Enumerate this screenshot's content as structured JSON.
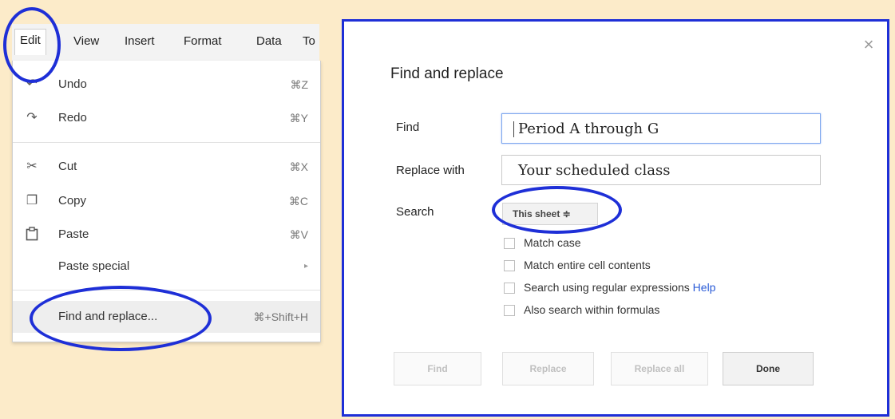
{
  "menubar": {
    "items": [
      "Edit",
      "View",
      "Insert",
      "Format",
      "Data",
      "To"
    ]
  },
  "dropdown": {
    "items": [
      {
        "icon": "undo-icon",
        "glyph": "↶",
        "label": "Undo",
        "shortcut": "⌘Z"
      },
      {
        "icon": "redo-icon",
        "glyph": "↷",
        "label": "Redo",
        "shortcut": "⌘Y"
      },
      {
        "icon": "scissors-icon",
        "glyph": "✂",
        "label": "Cut",
        "shortcut": "⌘X"
      },
      {
        "icon": "copy-icon",
        "glyph": "❐",
        "label": "Copy",
        "shortcut": "⌘C"
      },
      {
        "icon": "paste-icon",
        "glyph": "📋",
        "label": "Paste",
        "shortcut": "⌘V"
      },
      {
        "icon": "",
        "glyph": "",
        "label": "Paste special",
        "shortcut": "▸"
      },
      {
        "icon": "",
        "glyph": "",
        "label": "Find and replace...",
        "shortcut": "⌘+Shift+H"
      }
    ]
  },
  "dialog": {
    "title": "Find and replace",
    "close_glyph": "×",
    "find_label": "Find",
    "find_value": "Period A through G",
    "replace_label": "Replace with",
    "replace_value": "Your scheduled class",
    "search_label": "Search",
    "search_value": "This sheet ≑",
    "options": [
      {
        "label": "Match case"
      },
      {
        "label": "Match entire cell contents"
      },
      {
        "label": "Search using regular expressions",
        "link": "Help"
      },
      {
        "label": "Also search within formulas"
      }
    ],
    "buttons": {
      "find": "Find",
      "replace": "Replace",
      "replace_all": "Replace all",
      "done": "Done"
    }
  },
  "colors": {
    "background": "#fcebc9",
    "annotation": "#1e2fd7",
    "link": "#2a5bd7"
  }
}
